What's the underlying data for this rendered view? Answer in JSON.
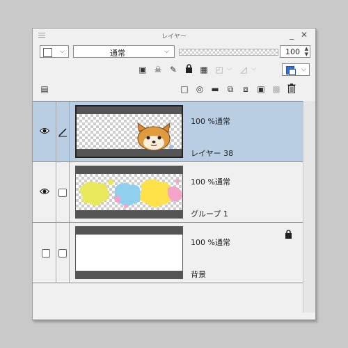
{
  "panel": {
    "title": "レイヤー",
    "minimize": "_",
    "close": "✕"
  },
  "toolbar": {
    "blend_mode": "通常",
    "opacity": "100",
    "icons": [
      "clip-to-lower-layer-icon",
      "reference-layer-icon",
      "draft-layer-icon",
      "lock-icon",
      "lock-transparent-pixels-icon",
      "mask-options-icon",
      "ruler-options-icon",
      "layer-color-icon"
    ]
  },
  "layers": [
    {
      "opacity_mode": "100 %通常",
      "name": "レイヤー 38",
      "visible": true,
      "selected": true,
      "locked": false
    },
    {
      "opacity_mode": "100 %通常",
      "name": "グループ 1",
      "visible": true,
      "selected": false,
      "locked": false
    },
    {
      "opacity_mode": "100 %通常",
      "name": "背景",
      "visible": false,
      "selected": false,
      "locked": true
    }
  ],
  "colors": {
    "selected_row": "#b9cde3",
    "layer_color": "#2f6fd8"
  }
}
